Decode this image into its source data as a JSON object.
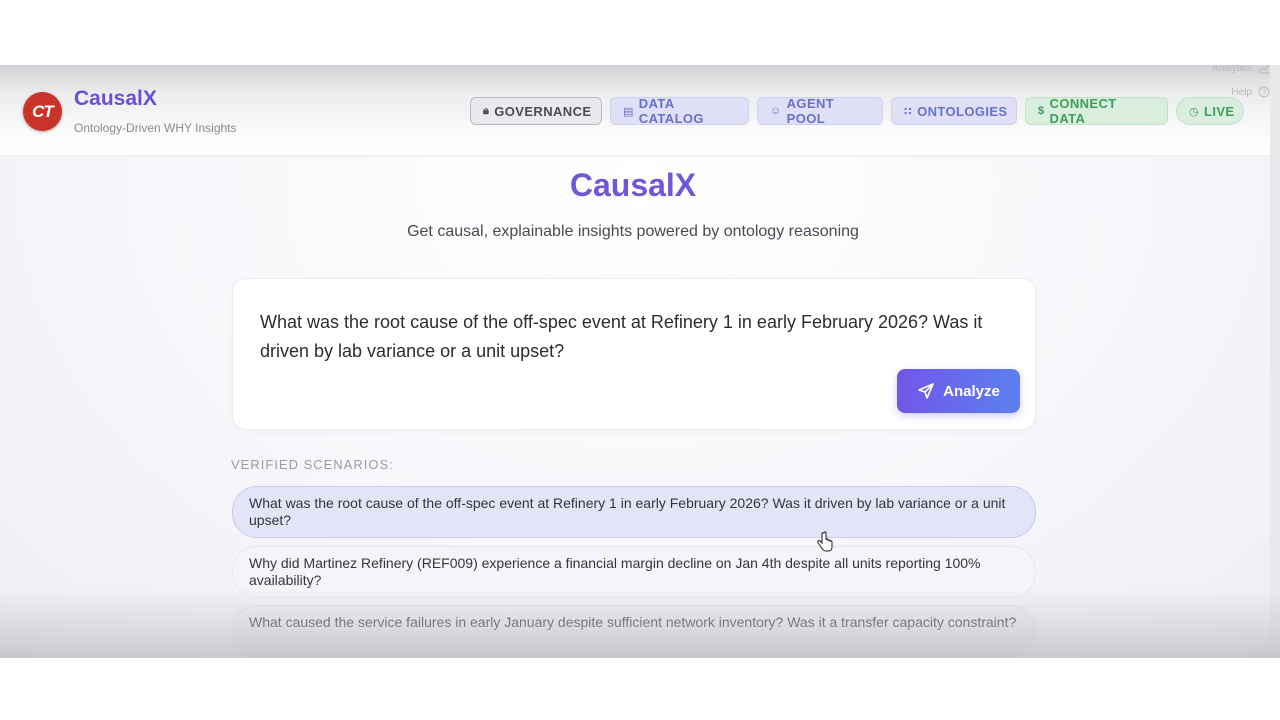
{
  "header": {
    "logo_text": "CT",
    "brand": "CausalX",
    "tagline": "Ontology-Driven WHY Insights",
    "analytics_label": "Analytics",
    "help_label": "Help",
    "nav": [
      {
        "label": "GOVERNANCE",
        "icon": "lock-icon"
      },
      {
        "label": "DATA CATALOG",
        "icon": "table-icon"
      },
      {
        "label": "AGENT POOL",
        "icon": "users-icon"
      },
      {
        "label": "ONTOLOGIES",
        "icon": "grid-icon"
      },
      {
        "label": "CONNECT DATA",
        "icon": "dollar-icon"
      },
      {
        "label": "LIVE",
        "icon": "clock-icon"
      }
    ]
  },
  "hero": {
    "title": "CausalX",
    "subtitle": "Get causal, explainable insights powered by ontology reasoning"
  },
  "query": {
    "text": "What was the root cause of the off-spec event at Refinery 1 in early February 2026? Was it driven by lab variance or a unit upset?",
    "button_label": "Analyze"
  },
  "scenarios": {
    "label": "VERIFIED SCENARIOS:",
    "items": [
      "What was the root cause of the off-spec event at Refinery 1 in early February 2026? Was it driven by lab variance or a unit upset?",
      "Why did Martinez Refinery (REF009) experience a financial margin decline on Jan 4th despite all units reporting 100% availability?",
      "What caused the service failures in early January despite sufficient network inventory? Was it a transfer capacity constraint?"
    ]
  },
  "colors": {
    "accent": "#7156d8",
    "green": "#3f9e5b",
    "logo": "#c8342a"
  }
}
